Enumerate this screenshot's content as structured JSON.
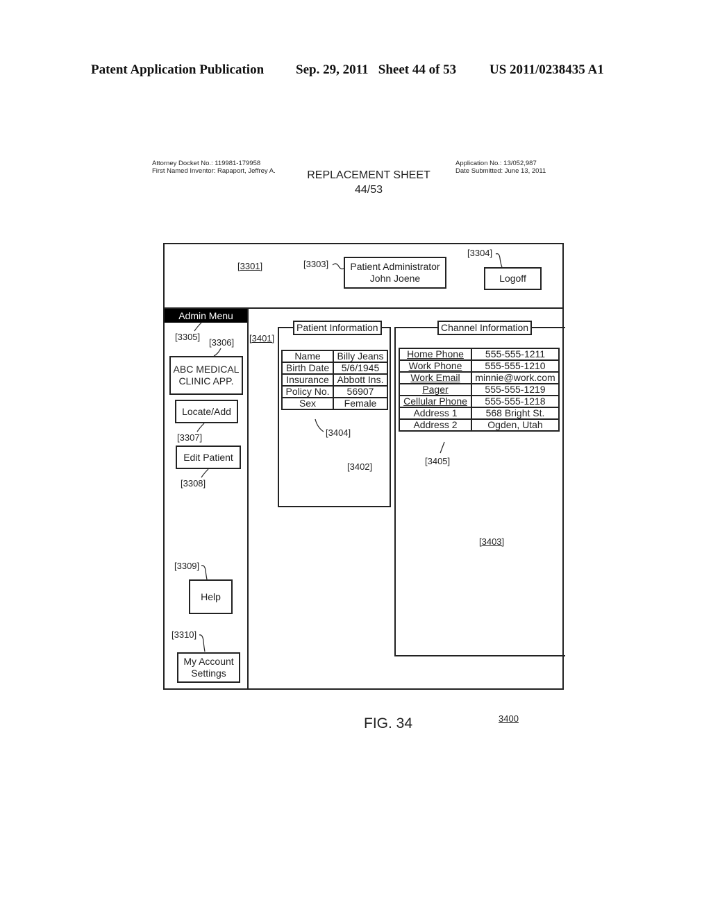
{
  "publication_header": {
    "left": "Patent Application Publication",
    "date_sheet": "Sep. 29, 2011   Sheet 44 of 53",
    "number": "US 2011/0238435 A1"
  },
  "submission_meta": {
    "docket": "Attorney Docket No.: 119981-179958",
    "inventor": "First Named Inventor: Rapaport, Jeffrey A.",
    "application": "Application No.: 13/052,987",
    "date_submitted": "Date Submitted: June 13, 2011",
    "replacement_title": "REPLACEMENT SHEET",
    "replacement_page": "44/53"
  },
  "drawing": {
    "header": {
      "ref_area": "[3301]",
      "ref_user": "[3303]",
      "user_box_line1": "Patient Administrator",
      "user_box_line2": "John Joene",
      "ref_logoff": "[3304]",
      "logoff_label": "Logoff"
    },
    "sidebar": {
      "menu_title": "Admin Menu",
      "ref_menu": "[3305]",
      "ref_app": "[3306]",
      "app_line1": "ABC MEDICAL",
      "app_line2": "CLINIC APP.",
      "locate_add_label": "Locate/Add",
      "ref_locate": "[3307]",
      "edit_patient_label": "Edit Patient",
      "ref_edit": "[3308]",
      "ref_help": "[3309]",
      "help_label": "Help",
      "ref_account": "[3310]",
      "account_line1": "My Account",
      "account_line2": "Settings"
    },
    "main": {
      "ref_main": "[3401]",
      "patient_info": {
        "title": "Patient Information",
        "ref_table": "[3404]",
        "ref_panel": "[3402]",
        "rows": [
          {
            "label": "Name",
            "value": "Billy Jeans"
          },
          {
            "label": "Birth Date",
            "value": "5/6/1945"
          },
          {
            "label": "Insurance",
            "value": "Abbott Ins."
          },
          {
            "label": "Policy No.",
            "value": "56907"
          },
          {
            "label": "Sex",
            "value": "Female"
          }
        ]
      },
      "channel_info": {
        "title": "Channel Information",
        "ref_table": "[3405]",
        "ref_panel": "[3403]",
        "rows": [
          {
            "label": "Home Phone",
            "value": "555-555-1211",
            "link": true
          },
          {
            "label": "Work Phone",
            "value": "555-555-1210",
            "link": true
          },
          {
            "label": "Work Email",
            "value": "minnie@work.com",
            "link": true
          },
          {
            "label": "Pager",
            "value": "555-555-1219",
            "link": true
          },
          {
            "label": "Cellular Phone",
            "value": "555-555-1218",
            "link": true
          },
          {
            "label": "Address 1",
            "value": "568 Bright St.",
            "link": false
          },
          {
            "label": "Address 2",
            "value": "Ogden, Utah",
            "link": false
          }
        ]
      }
    },
    "figure_label": "FIG. 34",
    "figure_ref": "3400"
  }
}
